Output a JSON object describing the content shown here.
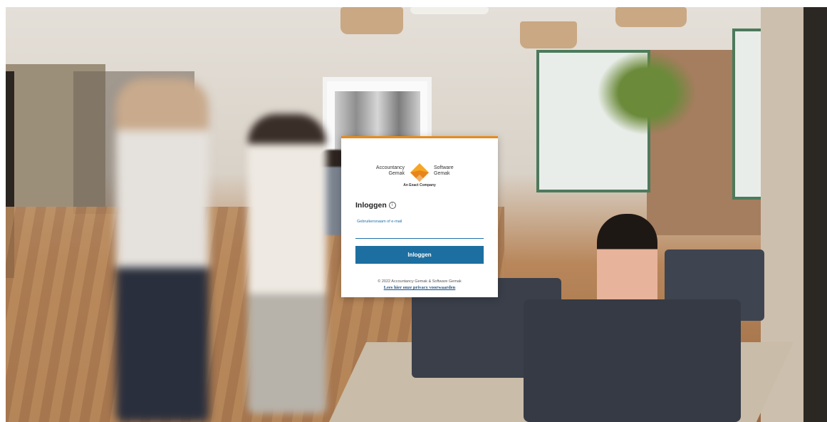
{
  "login": {
    "logo": {
      "left_line1": "Accountancy",
      "left_line2": "Gemak",
      "right_line1": "Software",
      "right_line2": "Gemak",
      "tagline": "An Exact Company"
    },
    "heading": "Inloggen",
    "info_icon": "i",
    "field_label": "Gebruikersnaam of e-mail",
    "field_value": "",
    "submit_label": "Inloggen",
    "copyright": "© 2022 Accountancy Gemak & Software Gemak",
    "privacy_link": "Lees hier onze privacy voorwaarden"
  },
  "colors": {
    "accent": "#e68a1c",
    "button": "#1c6fa0",
    "link": "#1a4f82"
  },
  "icons": {
    "logo": "diamond-chevron-logo-icon",
    "info": "info-circle-icon"
  }
}
